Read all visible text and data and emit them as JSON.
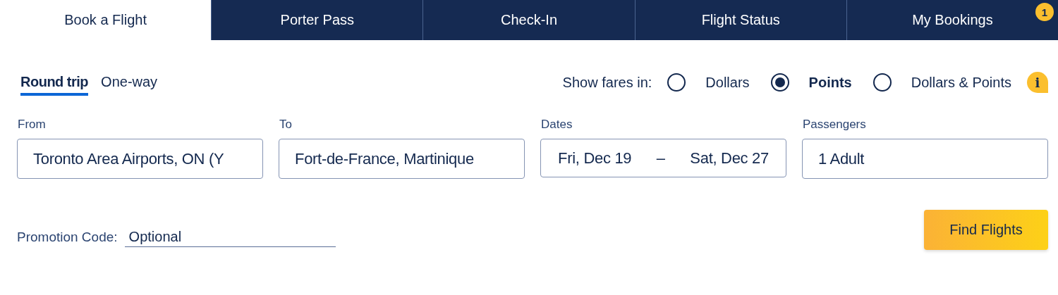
{
  "tabs": [
    {
      "label": "Book a Flight",
      "selected": true
    },
    {
      "label": "Porter Pass",
      "selected": false
    },
    {
      "label": "Check-In",
      "selected": false
    },
    {
      "label": "Flight Status",
      "selected": false
    },
    {
      "label": "My Bookings",
      "selected": false,
      "badge": "1"
    }
  ],
  "trip_types": [
    {
      "label": "Round trip",
      "selected": true
    },
    {
      "label": "One-way",
      "selected": false
    }
  ],
  "fares": {
    "label": "Show fares in:",
    "options": [
      {
        "label": "Dollars",
        "selected": false
      },
      {
        "label": "Points",
        "selected": true
      },
      {
        "label": "Dollars & Points",
        "selected": false
      }
    ],
    "info": "i"
  },
  "fields": [
    {
      "kind": "text",
      "label": "From",
      "value": "Toronto Area Airports, ON (Y"
    },
    {
      "kind": "text",
      "label": "To",
      "value": "Fort-de-France, Martinique"
    },
    {
      "kind": "dates",
      "label": "Dates",
      "start": "Fri, Dec 19",
      "separator": "–",
      "end": "Sat, Dec 27"
    },
    {
      "kind": "text",
      "label": "Passengers",
      "value": "1 Adult"
    }
  ],
  "promotion": {
    "label": "Promotion Code:",
    "placeholder": "Optional"
  },
  "submit": "Find Flights"
}
